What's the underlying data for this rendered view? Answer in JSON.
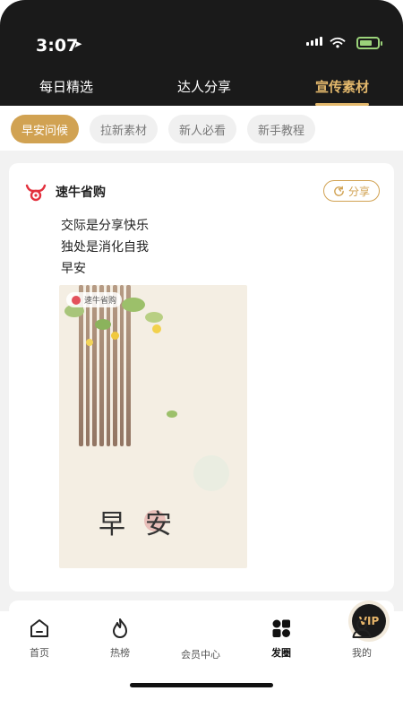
{
  "status_bar": {
    "time": "3:07",
    "battery_fill_percent": 70
  },
  "top_tabs": [
    {
      "label": "每日精选",
      "active": false
    },
    {
      "label": "达人分享",
      "active": false
    },
    {
      "label": "宣传素材",
      "active": true
    }
  ],
  "filter_pills": [
    {
      "label": "早安问候",
      "active": true
    },
    {
      "label": "拉新素材",
      "active": false
    },
    {
      "label": "新人必看",
      "active": false
    },
    {
      "label": "新手教程",
      "active": false
    }
  ],
  "post": {
    "brand_name": "速牛省购",
    "share_label": "分享",
    "lines": [
      "交际是分享快乐",
      "独处是消化自我",
      "早安"
    ],
    "poster": {
      "brand_tag": "速牛省购",
      "title": "早安"
    }
  },
  "bottom_nav": [
    {
      "label": "首页",
      "icon": "home-icon",
      "active": false
    },
    {
      "label": "热榜",
      "icon": "flame-icon",
      "active": false
    },
    {
      "label": "会员中心",
      "icon": "vip-crown-icon",
      "active": false
    },
    {
      "label": "发圈",
      "icon": "grid-icon",
      "active": true
    },
    {
      "label": "我的",
      "icon": "profile-icon",
      "active": false
    }
  ],
  "vip_badge_text": "VIP",
  "colors": {
    "accent_gold": "#d1a252",
    "tab_active": "#e3b86c",
    "header_dark": "#1a1a1a"
  }
}
